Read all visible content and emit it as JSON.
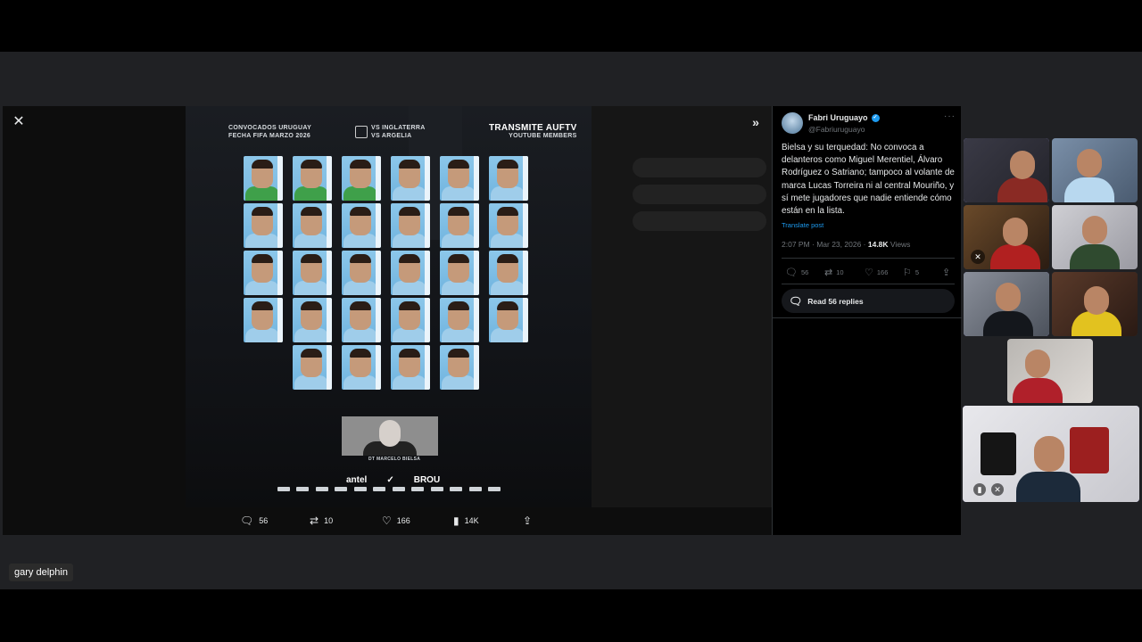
{
  "poster": {
    "heading_left_1": "CONVOCADOS URUGUAY",
    "heading_left_2": "FECHA FIFA MARZO 2026",
    "heading_mid_1": "VS INGLATERRA",
    "heading_mid_2": "VS ARGELIA",
    "heading_right_1": "TRANSMITE AUFTV",
    "heading_right_2": "YOUTUBE MEMBERS",
    "coach_label": "DT MARCELO BIELSA",
    "sponsor_1": "antel",
    "sponsor_3": "BROU"
  },
  "media_actions": {
    "replies": "56",
    "reposts": "10",
    "likes": "166",
    "views": "14K"
  },
  "icons": {
    "close": "close-icon",
    "expand": "chevrons-right-icon",
    "reply": "reply-icon",
    "repost": "repost-icon",
    "like": "heart-icon",
    "views": "bar-chart-icon",
    "share": "share-icon",
    "bookmark": "bookmark-icon"
  },
  "tweet": {
    "author_name": "Fabri Uruguayo",
    "author_handle": "@Fabriuruguayo",
    "body": "Bielsa y su terquedad: No convoca a delanteros como Miguel Merentiel, Álvaro Rodríguez o Satriano; tampoco al volante de marca Lucas Torreira ni al central Mouriño, y sí mete jugadores que nadie entiende cómo están en la lista.",
    "translate": "Translate post",
    "time": "2:07 PM · Mar 23, 2026 · ",
    "views_count": "14.8K",
    "views_label": " Views",
    "replies": "56",
    "reposts": "10",
    "likes": "166",
    "bookmarks": "5",
    "read_replies": "Read 56 replies"
  },
  "presenter": {
    "name": "gary delphin"
  },
  "colors": {
    "accent": "#1d9bf0",
    "active_speaker": "#a8a4ff",
    "card_blue": "#8cc7ea"
  }
}
